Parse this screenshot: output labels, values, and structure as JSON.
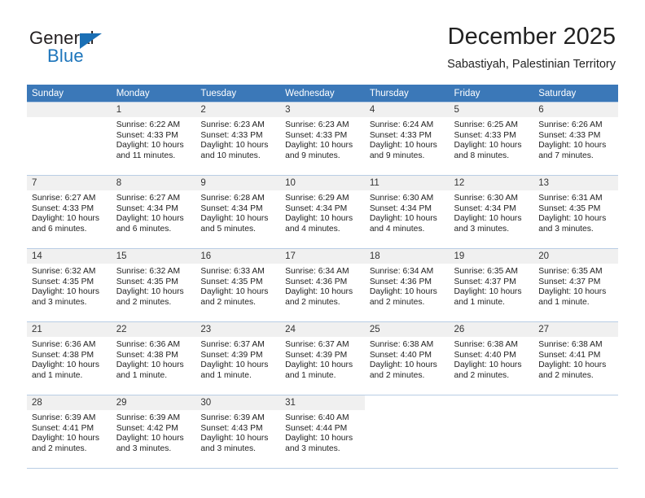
{
  "brand": {
    "name_part1": "General",
    "name_part2": "Blue",
    "triangle_color": "#1a6fb5",
    "blue_color": "#1d75bb"
  },
  "header": {
    "title": "December 2025",
    "subtitle": "Sabastiyah, Palestinian Territory",
    "header_bg": "#3b78b8",
    "header_text_color": "#ffffff"
  },
  "weekdays": [
    "Sunday",
    "Monday",
    "Tuesday",
    "Wednesday",
    "Thursday",
    "Friday",
    "Saturday"
  ],
  "weeks": [
    [
      {
        "day": "",
        "sunrise": "",
        "sunset": "",
        "daylight1": "",
        "daylight2": ""
      },
      {
        "day": "1",
        "sunrise": "Sunrise: 6:22 AM",
        "sunset": "Sunset: 4:33 PM",
        "daylight1": "Daylight: 10 hours",
        "daylight2": "and 11 minutes."
      },
      {
        "day": "2",
        "sunrise": "Sunrise: 6:23 AM",
        "sunset": "Sunset: 4:33 PM",
        "daylight1": "Daylight: 10 hours",
        "daylight2": "and 10 minutes."
      },
      {
        "day": "3",
        "sunrise": "Sunrise: 6:23 AM",
        "sunset": "Sunset: 4:33 PM",
        "daylight1": "Daylight: 10 hours",
        "daylight2": "and 9 minutes."
      },
      {
        "day": "4",
        "sunrise": "Sunrise: 6:24 AM",
        "sunset": "Sunset: 4:33 PM",
        "daylight1": "Daylight: 10 hours",
        "daylight2": "and 9 minutes."
      },
      {
        "day": "5",
        "sunrise": "Sunrise: 6:25 AM",
        "sunset": "Sunset: 4:33 PM",
        "daylight1": "Daylight: 10 hours",
        "daylight2": "and 8 minutes."
      },
      {
        "day": "6",
        "sunrise": "Sunrise: 6:26 AM",
        "sunset": "Sunset: 4:33 PM",
        "daylight1": "Daylight: 10 hours",
        "daylight2": "and 7 minutes."
      }
    ],
    [
      {
        "day": "7",
        "sunrise": "Sunrise: 6:27 AM",
        "sunset": "Sunset: 4:33 PM",
        "daylight1": "Daylight: 10 hours",
        "daylight2": "and 6 minutes."
      },
      {
        "day": "8",
        "sunrise": "Sunrise: 6:27 AM",
        "sunset": "Sunset: 4:34 PM",
        "daylight1": "Daylight: 10 hours",
        "daylight2": "and 6 minutes."
      },
      {
        "day": "9",
        "sunrise": "Sunrise: 6:28 AM",
        "sunset": "Sunset: 4:34 PM",
        "daylight1": "Daylight: 10 hours",
        "daylight2": "and 5 minutes."
      },
      {
        "day": "10",
        "sunrise": "Sunrise: 6:29 AM",
        "sunset": "Sunset: 4:34 PM",
        "daylight1": "Daylight: 10 hours",
        "daylight2": "and 4 minutes."
      },
      {
        "day": "11",
        "sunrise": "Sunrise: 6:30 AM",
        "sunset": "Sunset: 4:34 PM",
        "daylight1": "Daylight: 10 hours",
        "daylight2": "and 4 minutes."
      },
      {
        "day": "12",
        "sunrise": "Sunrise: 6:30 AM",
        "sunset": "Sunset: 4:34 PM",
        "daylight1": "Daylight: 10 hours",
        "daylight2": "and 3 minutes."
      },
      {
        "day": "13",
        "sunrise": "Sunrise: 6:31 AM",
        "sunset": "Sunset: 4:35 PM",
        "daylight1": "Daylight: 10 hours",
        "daylight2": "and 3 minutes."
      }
    ],
    [
      {
        "day": "14",
        "sunrise": "Sunrise: 6:32 AM",
        "sunset": "Sunset: 4:35 PM",
        "daylight1": "Daylight: 10 hours",
        "daylight2": "and 3 minutes."
      },
      {
        "day": "15",
        "sunrise": "Sunrise: 6:32 AM",
        "sunset": "Sunset: 4:35 PM",
        "daylight1": "Daylight: 10 hours",
        "daylight2": "and 2 minutes."
      },
      {
        "day": "16",
        "sunrise": "Sunrise: 6:33 AM",
        "sunset": "Sunset: 4:35 PM",
        "daylight1": "Daylight: 10 hours",
        "daylight2": "and 2 minutes."
      },
      {
        "day": "17",
        "sunrise": "Sunrise: 6:34 AM",
        "sunset": "Sunset: 4:36 PM",
        "daylight1": "Daylight: 10 hours",
        "daylight2": "and 2 minutes."
      },
      {
        "day": "18",
        "sunrise": "Sunrise: 6:34 AM",
        "sunset": "Sunset: 4:36 PM",
        "daylight1": "Daylight: 10 hours",
        "daylight2": "and 2 minutes."
      },
      {
        "day": "19",
        "sunrise": "Sunrise: 6:35 AM",
        "sunset": "Sunset: 4:37 PM",
        "daylight1": "Daylight: 10 hours",
        "daylight2": "and 1 minute."
      },
      {
        "day": "20",
        "sunrise": "Sunrise: 6:35 AM",
        "sunset": "Sunset: 4:37 PM",
        "daylight1": "Daylight: 10 hours",
        "daylight2": "and 1 minute."
      }
    ],
    [
      {
        "day": "21",
        "sunrise": "Sunrise: 6:36 AM",
        "sunset": "Sunset: 4:38 PM",
        "daylight1": "Daylight: 10 hours",
        "daylight2": "and 1 minute."
      },
      {
        "day": "22",
        "sunrise": "Sunrise: 6:36 AM",
        "sunset": "Sunset: 4:38 PM",
        "daylight1": "Daylight: 10 hours",
        "daylight2": "and 1 minute."
      },
      {
        "day": "23",
        "sunrise": "Sunrise: 6:37 AM",
        "sunset": "Sunset: 4:39 PM",
        "daylight1": "Daylight: 10 hours",
        "daylight2": "and 1 minute."
      },
      {
        "day": "24",
        "sunrise": "Sunrise: 6:37 AM",
        "sunset": "Sunset: 4:39 PM",
        "daylight1": "Daylight: 10 hours",
        "daylight2": "and 1 minute."
      },
      {
        "day": "25",
        "sunrise": "Sunrise: 6:38 AM",
        "sunset": "Sunset: 4:40 PM",
        "daylight1": "Daylight: 10 hours",
        "daylight2": "and 2 minutes."
      },
      {
        "day": "26",
        "sunrise": "Sunrise: 6:38 AM",
        "sunset": "Sunset: 4:40 PM",
        "daylight1": "Daylight: 10 hours",
        "daylight2": "and 2 minutes."
      },
      {
        "day": "27",
        "sunrise": "Sunrise: 6:38 AM",
        "sunset": "Sunset: 4:41 PM",
        "daylight1": "Daylight: 10 hours",
        "daylight2": "and 2 minutes."
      }
    ],
    [
      {
        "day": "28",
        "sunrise": "Sunrise: 6:39 AM",
        "sunset": "Sunset: 4:41 PM",
        "daylight1": "Daylight: 10 hours",
        "daylight2": "and 2 minutes."
      },
      {
        "day": "29",
        "sunrise": "Sunrise: 6:39 AM",
        "sunset": "Sunset: 4:42 PM",
        "daylight1": "Daylight: 10 hours",
        "daylight2": "and 3 minutes."
      },
      {
        "day": "30",
        "sunrise": "Sunrise: 6:39 AM",
        "sunset": "Sunset: 4:43 PM",
        "daylight1": "Daylight: 10 hours",
        "daylight2": "and 3 minutes."
      },
      {
        "day": "31",
        "sunrise": "Sunrise: 6:40 AM",
        "sunset": "Sunset: 4:44 PM",
        "daylight1": "Daylight: 10 hours",
        "daylight2": "and 3 minutes."
      },
      {
        "day": "",
        "sunrise": "",
        "sunset": "",
        "daylight1": "",
        "daylight2": ""
      },
      {
        "day": "",
        "sunrise": "",
        "sunset": "",
        "daylight1": "",
        "daylight2": ""
      },
      {
        "day": "",
        "sunrise": "",
        "sunset": "",
        "daylight1": "",
        "daylight2": ""
      }
    ]
  ]
}
